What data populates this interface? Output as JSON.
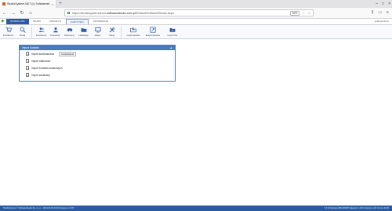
{
  "browser": {
    "tab_title": "StudioSystem.NET (c) Softwaresti",
    "url_prefix": "https://studiosystemdemo.",
    "url_domain": "softwarestudio.com.pl",
    "url_path": "/Default/SoftwareStudio.aspx",
    "zoom": "80%",
    "dots": "···",
    "star": "☆"
  },
  "app": {
    "tabs": [
      {
        "label": "Studio Lite"
      },
      {
        "label": "Biuro"
      },
      {
        "label": "Magazyn"
      },
      {
        "label": "Kartoteki"
      },
      {
        "label": "Informacje"
      }
    ],
    "user_info": "Aplikacja klienci"
  },
  "ribbon": {
    "buttons": [
      {
        "label": "Kontrahenci",
        "icon": "cart-icon"
      },
      {
        "label": "Szukaj",
        "icon": "search-icon"
      },
      {
        "label": "Kontrahenci",
        "icon": "contacts-icon"
      },
      {
        "label": "Pracownicy",
        "icon": "people-icon"
      },
      {
        "label": "Dokumenty",
        "icon": "car-icon"
      },
      {
        "label": "Lokalizacje",
        "icon": "folder-icon"
      },
      {
        "label": "Waluty",
        "icon": "monitor-icon"
      },
      {
        "label": "Usługi",
        "icon": "tools-icon"
      },
      {
        "label": "Import kartotek",
        "icon": "import-folder-icon"
      },
      {
        "label": "Eksport kartotek",
        "icon": "export-icon"
      },
      {
        "label": "Import CSV",
        "icon": "csv-folder-icon"
      }
    ]
  },
  "panel": {
    "title": "Import Kartotek",
    "items": [
      {
        "label": "Import kontrahentów",
        "tooltip": "Kontrahenci"
      },
      {
        "label": "Import odbiorców"
      },
      {
        "label": "Import Kartotek towarowych"
      },
      {
        "label": "Import lokalizacji"
      }
    ]
  },
  "statusbar": {
    "left": "StudioSystem © SoftwareStudio Sp. z o.o. - 2019-03-06 10:04     Ostatnio: 2.3.57",
    "right": "7.3 Schedulers 800-MKWP Magazyn: UCZ Uczelnia | UAI: Firma: 23.00"
  },
  "colors": {
    "accent": "#2c5aa0",
    "panel_header": "#4a78b8"
  }
}
